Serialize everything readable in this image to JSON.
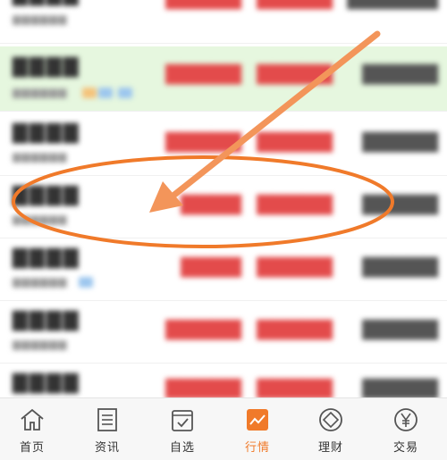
{
  "tabs": [
    {
      "label": "首页",
      "icon": "home-icon"
    },
    {
      "label": "资讯",
      "icon": "news-icon"
    },
    {
      "label": "自选",
      "icon": "watchlist-icon"
    },
    {
      "label": "行情",
      "icon": "market-chart-icon",
      "active": true
    },
    {
      "label": "理财",
      "icon": "wealth-icon"
    },
    {
      "label": "交易",
      "icon": "trade-yen-icon"
    }
  ],
  "colors": {
    "accent": "#f07a2a",
    "rise": "#e34b4b",
    "highlight_row": "#e6f7df"
  }
}
